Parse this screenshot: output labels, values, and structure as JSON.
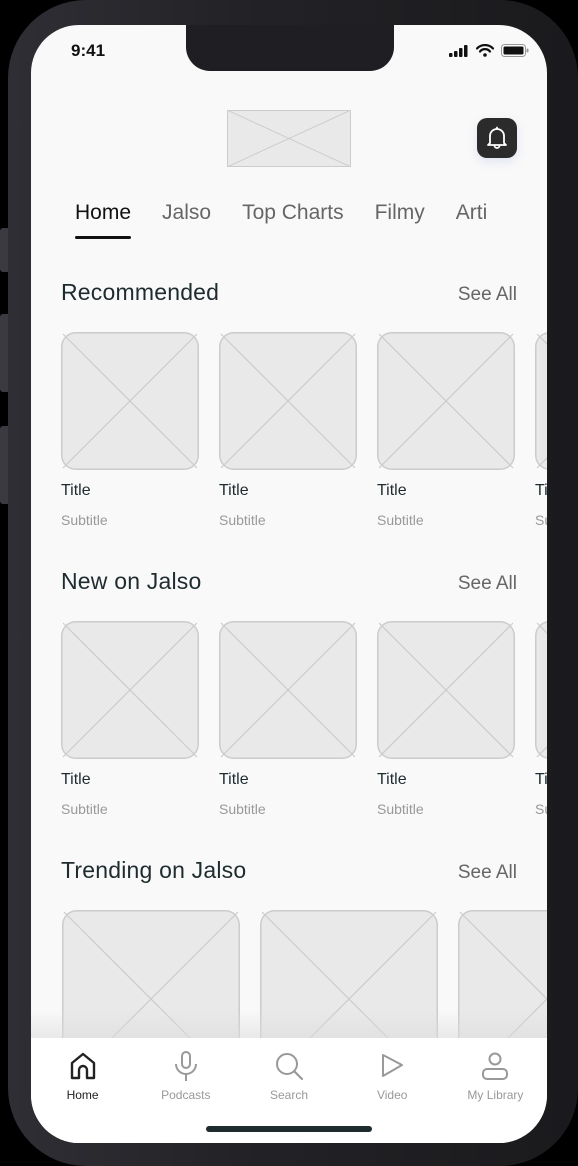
{
  "status_bar": {
    "time": "9:41"
  },
  "header": {
    "logo_placeholder": "logo-placeholder",
    "notification_icon": "bell-icon"
  },
  "tabs": [
    {
      "label": "Home",
      "active": true
    },
    {
      "label": "Jalso",
      "active": false
    },
    {
      "label": "Top Charts",
      "active": false
    },
    {
      "label": "Filmy",
      "active": false
    },
    {
      "label": "Arti",
      "active": false
    }
  ],
  "sections": [
    {
      "title": "Recommended",
      "see_all": "See All",
      "items": [
        {
          "title": "Title",
          "subtitle": "Subtitle"
        },
        {
          "title": "Title",
          "subtitle": "Subtitle"
        },
        {
          "title": "Title",
          "subtitle": "Subtitle"
        },
        {
          "title": "Title",
          "subtitle": "Subtitle"
        }
      ]
    },
    {
      "title": "New on Jalso",
      "see_all": "See All",
      "items": [
        {
          "title": "Title",
          "subtitle": "Subtitle"
        },
        {
          "title": "Title",
          "subtitle": "Subtitle"
        },
        {
          "title": "Title",
          "subtitle": "Subtitle"
        },
        {
          "title": "Title",
          "subtitle": "Subtitle"
        }
      ]
    },
    {
      "title": "Trending on Jalso",
      "see_all": "See All",
      "items": [
        {},
        {},
        {}
      ]
    }
  ],
  "bottom_nav": [
    {
      "label": "Home",
      "icon": "home-icon",
      "active": true
    },
    {
      "label": "Podcasts",
      "icon": "microphone-icon",
      "active": false
    },
    {
      "label": "Search",
      "icon": "search-icon",
      "active": false
    },
    {
      "label": "Video",
      "icon": "play-icon",
      "active": false
    },
    {
      "label": "My Library",
      "icon": "user-icon",
      "active": false
    }
  ]
}
